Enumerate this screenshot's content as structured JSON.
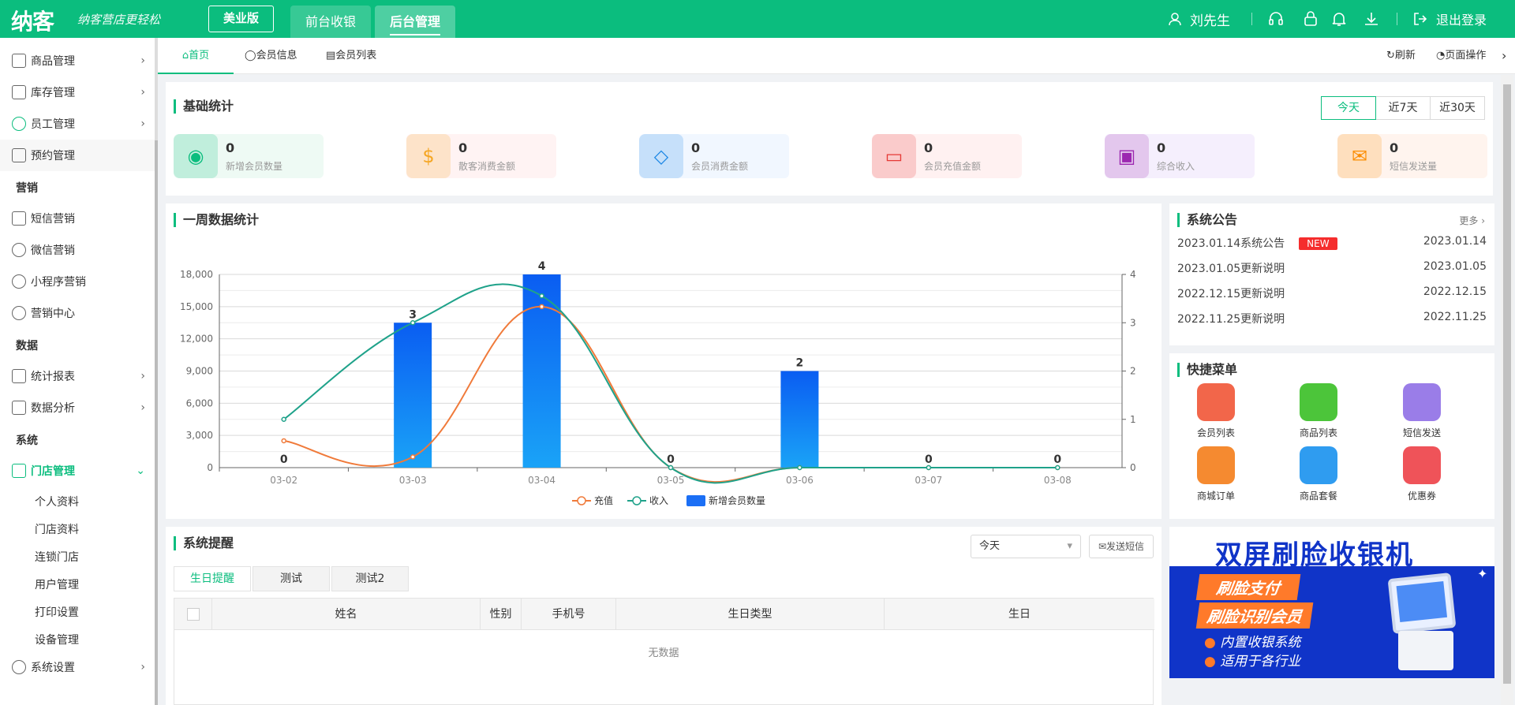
{
  "header": {
    "logo": "纳客",
    "slogan": "纳客营店更轻松",
    "edition": "美业版",
    "tabs": [
      {
        "label": "前台收银"
      },
      {
        "label": "后台管理"
      }
    ],
    "user": "刘先生",
    "logout": "退出登录"
  },
  "sidebar": {
    "items": [
      {
        "label": "商品管理"
      },
      {
        "label": "库存管理"
      },
      {
        "label": "员工管理"
      },
      {
        "label": "预约管理"
      }
    ],
    "group_marketing": "营销",
    "marketing": [
      {
        "label": "短信营销"
      },
      {
        "label": "微信营销"
      },
      {
        "label": "小程序营销"
      },
      {
        "label": "营销中心"
      }
    ],
    "group_data": "数据",
    "data": [
      {
        "label": "统计报表"
      },
      {
        "label": "数据分析"
      }
    ],
    "group_system": "系统",
    "store": {
      "label": "门店管理"
    },
    "store_sub": [
      {
        "label": "个人资料"
      },
      {
        "label": "门店资料"
      },
      {
        "label": "连锁门店"
      },
      {
        "label": "用户管理"
      },
      {
        "label": "打印设置"
      },
      {
        "label": "设备管理"
      }
    ],
    "settings": {
      "label": "系统设置"
    }
  },
  "page_tabs": [
    {
      "label": "首页"
    },
    {
      "label": "会员信息"
    },
    {
      "label": "会员列表"
    }
  ],
  "page_actions": {
    "refresh": "刷新",
    "page_ops": "页面操作"
  },
  "basic_stats": {
    "title": "基础统计",
    "ranges": [
      "今天",
      "近7天",
      "近30天"
    ],
    "items": [
      {
        "value": "0",
        "label": "新增会员数量",
        "color": "#0bbd7e",
        "bg": "#eefaf4"
      },
      {
        "value": "0",
        "label": "散客消费金额",
        "color": "#f5a623",
        "bg": "#fff3f3"
      },
      {
        "value": "0",
        "label": "会员消费金额",
        "color": "#1e88e5",
        "bg": "#f1f7ff"
      },
      {
        "value": "0",
        "label": "会员充值金额",
        "color": "#e53935",
        "bg": "#fff1f1"
      },
      {
        "value": "0",
        "label": "综合收入",
        "color": "#9c27b0",
        "bg": "#f5effd"
      },
      {
        "value": "0",
        "label": "短信发送量",
        "color": "#fb8c00",
        "bg": "#fff4ee"
      }
    ]
  },
  "weekly": {
    "title": "一周数据统计"
  },
  "chart_data": {
    "type": "bar",
    "categories": [
      "03-02",
      "03-03",
      "03-04",
      "03-05",
      "03-06",
      "03-07",
      "03-08"
    ],
    "series": [
      {
        "name": "充值",
        "type": "line",
        "axis": "left",
        "color": "#f07a3a",
        "values": [
          2500,
          1000,
          15000,
          0,
          0,
          0,
          0
        ]
      },
      {
        "name": "收入",
        "type": "line",
        "axis": "left",
        "color": "#1fa28a",
        "values": [
          4500,
          13500,
          16000,
          0,
          0,
          0,
          0
        ]
      },
      {
        "name": "新增会员数量",
        "type": "bar",
        "axis": "right",
        "color": "#1b6ff5",
        "values": [
          0,
          3,
          4,
          0,
          2,
          0,
          0
        ]
      }
    ],
    "yleft": {
      "ticks": [
        "18,000",
        "15,000",
        "12,000",
        "9,000",
        "6,000",
        "3,000",
        "0"
      ],
      "ylim": [
        0,
        18000
      ]
    },
    "yright": {
      "ticks": [
        "4",
        "3",
        "2",
        "1",
        "0"
      ],
      "ylim": [
        0,
        4
      ]
    },
    "grid": true,
    "legend": "bottom"
  },
  "announce": {
    "title": "系统公告",
    "more": "更多",
    "new_badge": "NEW",
    "items": [
      {
        "title": "2023.01.14系统公告",
        "date": "2023.01.14"
      },
      {
        "title": "2023.01.05更新说明",
        "date": "2023.01.05"
      },
      {
        "title": "2022.12.15更新说明",
        "date": "2022.12.15"
      },
      {
        "title": "2022.11.25更新说明",
        "date": "2022.11.25"
      }
    ]
  },
  "quick": {
    "title": "快捷菜单",
    "items": [
      {
        "label": "会员列表",
        "color": "#f2664a"
      },
      {
        "label": "商品列表",
        "color": "#4cc53a"
      },
      {
        "label": "短信发送",
        "color": "#9a7de8"
      },
      {
        "label": "商城订单",
        "color": "#f58a30"
      },
      {
        "label": "商品套餐",
        "color": "#2f9cf0"
      },
      {
        "label": "优惠券",
        "color": "#ef5359"
      }
    ]
  },
  "reminder": {
    "title": "系统提醒",
    "select": "今天",
    "send_sms": "发送短信",
    "tabs": [
      "生日提醒",
      "测试",
      "测试2"
    ],
    "columns": [
      "姓名",
      "性别",
      "手机号",
      "生日类型",
      "生日"
    ],
    "empty": "无数据"
  },
  "banner": {
    "title": "双屏刷脸收银机",
    "line1": "刷脸支付",
    "line2": "刷脸识别会员",
    "bullet1": "内置收银系统",
    "bullet2": "适用于各行业"
  }
}
